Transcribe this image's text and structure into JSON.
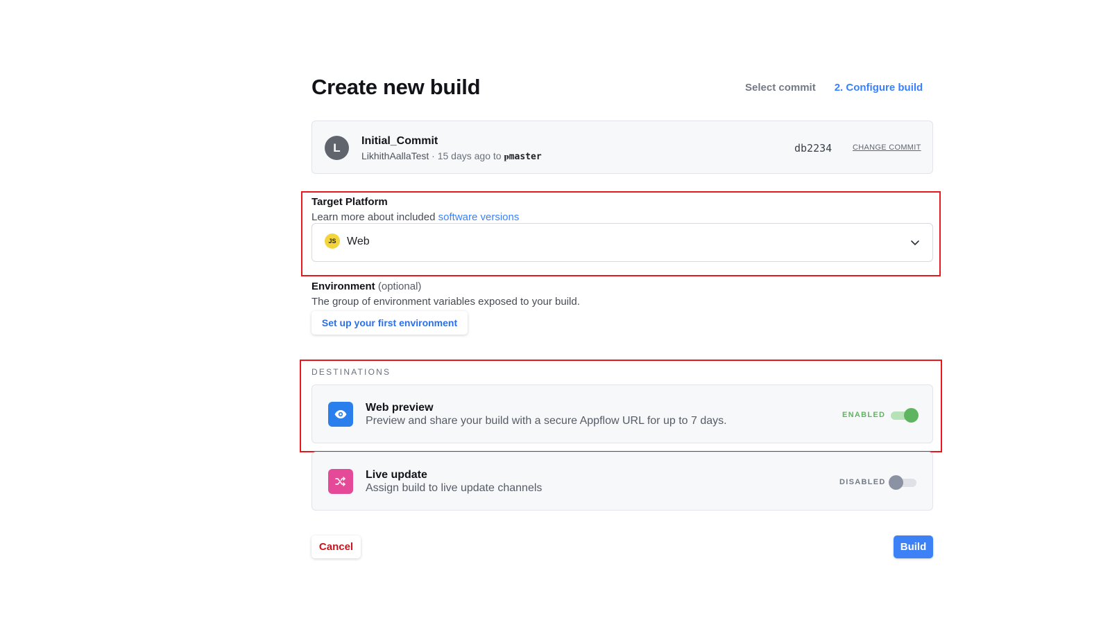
{
  "page": {
    "title": "Create new build"
  },
  "steps": [
    {
      "label": "Select commit",
      "active": false
    },
    {
      "label": "2. Configure build",
      "active": true
    }
  ],
  "commit": {
    "avatar_initial": "L",
    "title": "Initial_Commit",
    "author": "LikhithAallaTest",
    "when": "· 15 days ago to",
    "branch_icon": "git-branch-icon",
    "branch_glyph": "ᵽ",
    "branch": "master",
    "hash": "db2234",
    "change_label": "CHANGE COMMIT"
  },
  "target_platform": {
    "label": "Target Platform",
    "help_prefix": "Learn more about included",
    "help_link": "software versions",
    "selected_icon_text": "JS",
    "selected": "Web"
  },
  "environment": {
    "label": "Environment",
    "optional": "(optional)",
    "help": "The group of environment variables exposed to your build.",
    "button_label": "Set up your first environment"
  },
  "destinations": {
    "heading": "DESTINATIONS",
    "items": [
      {
        "title": "Web preview",
        "description": "Preview and share your build with a secure Appflow URL for up to 7 days.",
        "status": "ENABLED",
        "enabled": true,
        "icon": "eye-icon"
      },
      {
        "title": "Live update",
        "description": "Assign build to live update channels",
        "status": "DISABLED",
        "enabled": false,
        "icon": "shuffle-icon"
      }
    ]
  },
  "actions": {
    "cancel_label": "Cancel",
    "build_label": "Build"
  },
  "colors": {
    "accent": "#3880ff",
    "danger": "#d0101a",
    "enabled": "#5fb45f",
    "highlight": "#e8171c"
  }
}
